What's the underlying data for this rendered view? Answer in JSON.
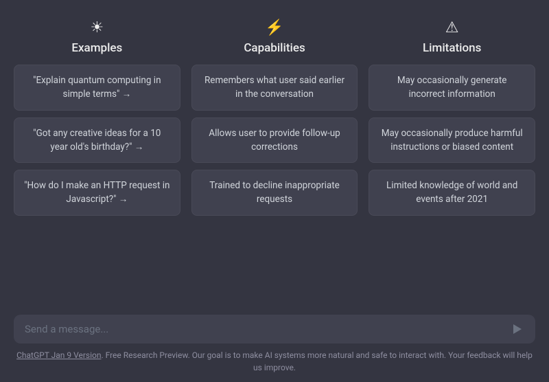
{
  "columns": [
    {
      "id": "examples",
      "icon": "☀",
      "title": "Examples",
      "cards": [
        {
          "text": "\"Explain quantum computing in simple terms\" →",
          "clickable": true
        },
        {
          "text": "\"Got any creative ideas for a 10 year old's birthday?\" →",
          "clickable": true
        },
        {
          "text": "\"How do I make an HTTP request in Javascript?\" →",
          "clickable": true
        }
      ]
    },
    {
      "id": "capabilities",
      "icon": "⚡",
      "title": "Capabilities",
      "cards": [
        {
          "text": "Remembers what user said earlier in the conversation",
          "clickable": false
        },
        {
          "text": "Allows user to provide follow-up corrections",
          "clickable": false
        },
        {
          "text": "Trained to decline inappropriate requests",
          "clickable": false
        }
      ]
    },
    {
      "id": "limitations",
      "icon": "⚠",
      "title": "Limitations",
      "cards": [
        {
          "text": "May occasionally generate incorrect information",
          "clickable": false
        },
        {
          "text": "May occasionally produce harmful instructions or biased content",
          "clickable": false
        },
        {
          "text": "Limited knowledge of world and events after 2021",
          "clickable": false
        }
      ]
    }
  ],
  "input": {
    "placeholder": "Send a message...",
    "value": ""
  },
  "footer": {
    "link_text": "ChatGPT Jan 9 Version",
    "description": ". Free Research Preview. Our goal is to make AI systems more natural and safe to interact with. Your feedback will help us improve."
  }
}
